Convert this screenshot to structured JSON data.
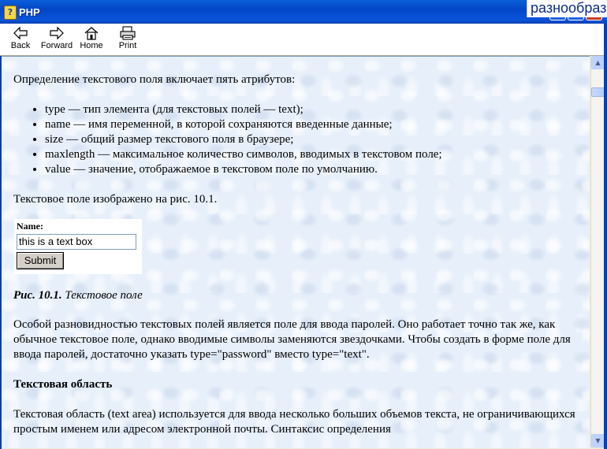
{
  "window": {
    "title": "PHP",
    "overlay_text": "разнообраз"
  },
  "toolbar": {
    "back_label": "Back",
    "forward_label": "Forward",
    "home_label": "Home",
    "print_label": "Print"
  },
  "content": {
    "intro": "Определение текстового поля включает пять атрибутов:",
    "attributes": [
      "type — тип элемента (для текстовых полей — text);",
      "name — имя переменной, в которой сохраняются введенные данные;",
      "size — общий размер текстового поля в браузере;",
      "maxlength — максимальное количество символов, вводимых в текстовом поле;",
      "value — значение, отображаемое в текстовом поле по умолчанию."
    ],
    "figure_ref": "Текстовое поле изображено на рис. 10.1.",
    "demo": {
      "label": "Name:",
      "input_value": "this is a text box",
      "submit_label": "Submit"
    },
    "caption_bold": "Рис. 10.1.",
    "caption_text": " Текстовое поле",
    "password_paragraph": "Особой разновидностью текстовых полей является поле для ввода паролей. Оно работает точно так же, как обычное текстовое поле, однако вводимые символы заменяются звездочками. Чтобы создать в форме поле для ввода паролей, достаточно указать type=\"password\" вместо type=\"text\".",
    "heading": "Текстовая область",
    "textarea_paragraph": "Текстовая область (text area) используется для ввода несколько больших объемов текста, не ограничивающихся простым именем или адресом электронной почты. Синтаксис определения"
  }
}
